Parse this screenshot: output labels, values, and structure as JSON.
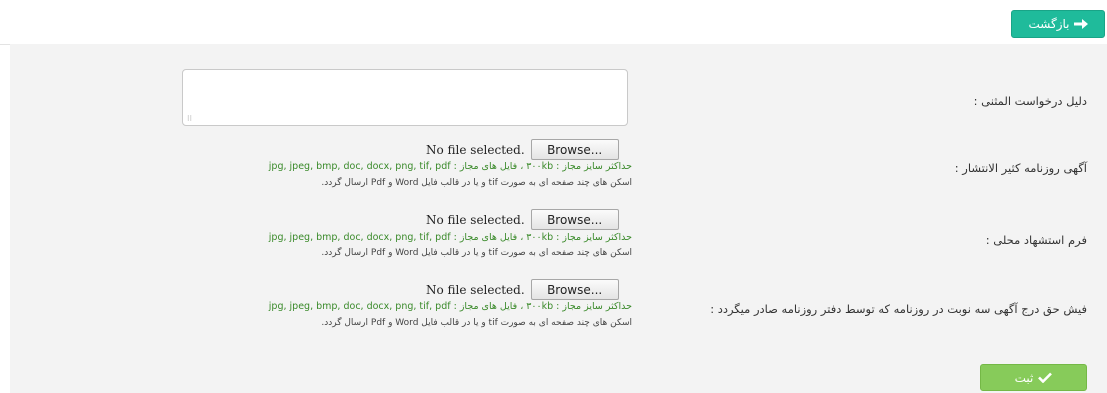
{
  "header": {
    "back_label": "بازگشت",
    "back_icon": "arrow-right-icon"
  },
  "fields": [
    {
      "label": "دلیل درخواست المثنی :"
    },
    {
      "label": "آگهی روزنامه کثیر الانتشار :"
    },
    {
      "label": "فرم استشهاد محلی :"
    },
    {
      "label": "فیش حق درج آگهی سه نوبت در روزنامه که توسط دفتر روزنامه صادر میگردد :"
    }
  ],
  "upload": {
    "browse_label": "Browse...",
    "status_text": "No file selected.",
    "hint_limits": "حداکثر سایز مجاز : ۳۰۰kb ، فایل های مجاز : jpg, jpeg, bmp, doc, docx, png, tif, pdf",
    "hint_scan": "اسکن های چند صفحه ای به صورت tif و یا در قالب فایل Word و Pdf ارسال گردد."
  },
  "footer": {
    "submit_label": "ثبت",
    "submit_icon": "check-icon"
  },
  "colors": {
    "back_button": "#1fbb9b",
    "submit_button": "#87cb5a",
    "hint_green": "#3a8a2a"
  }
}
